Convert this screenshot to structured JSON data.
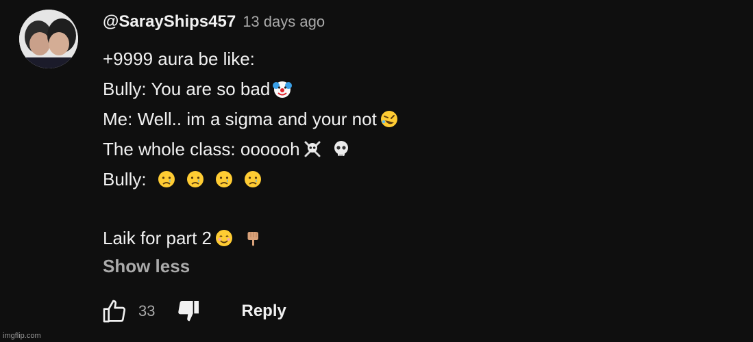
{
  "comment": {
    "handle": "@SarayShips457",
    "time": "13 days ago",
    "lines": [
      {
        "text": "+9999 aura be like:",
        "emojis": []
      },
      {
        "text": "Bully: You are so bad",
        "emojis": [
          "clown-face-icon"
        ]
      },
      {
        "text": "Me: Well.. im a sigma and your not",
        "emojis": [
          "rolling-laughing-icon"
        ]
      },
      {
        "text": "The whole class: oooooh",
        "emojis": [
          "skull-crossbones-icon",
          "skull-icon"
        ]
      },
      {
        "text": "Bully:",
        "emojis": [
          "crying-face-icon",
          "crying-face-icon",
          "crying-face-icon",
          "crying-face-icon"
        ]
      },
      {
        "text": "",
        "emojis": []
      },
      {
        "text": "Laik for part 2",
        "emojis": [
          "smiling-face-icon",
          "pointing-down-icon"
        ]
      }
    ],
    "show_less": "Show less"
  },
  "actions": {
    "like_count": "33",
    "reply_label": "Reply"
  },
  "watermark": "imgflip.com"
}
